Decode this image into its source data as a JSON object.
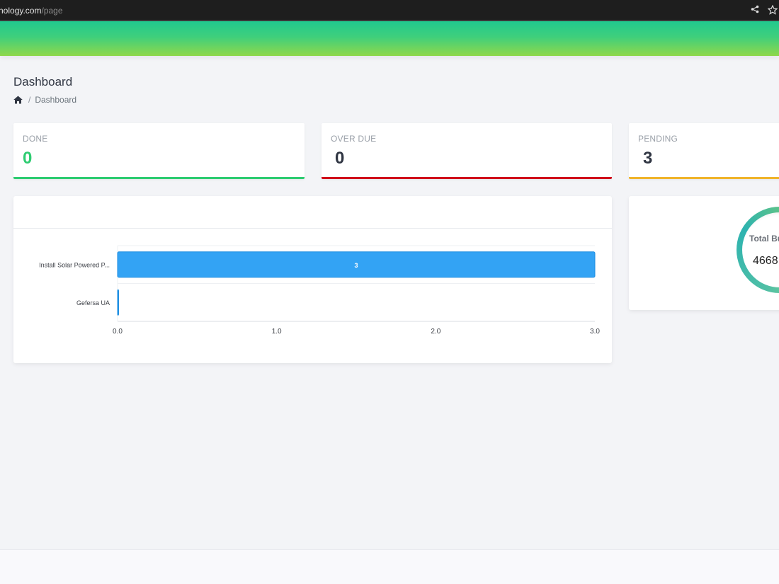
{
  "browser": {
    "url_host": "nology.com",
    "url_path": "/page",
    "share_icon": "share-icon",
    "star_icon": "star-icon"
  },
  "header": {
    "accent_gradient": [
      "#21c98f",
      "#8fd84a"
    ]
  },
  "page": {
    "title": "Dashboard",
    "breadcrumb": {
      "home_icon": "home-icon",
      "separator": "/",
      "current": "Dashboard"
    }
  },
  "stats": [
    {
      "label": "DONE",
      "value": "0",
      "color": "#2ecc71"
    },
    {
      "label": "OVER DUE",
      "value": "0",
      "color": "#d0021b"
    },
    {
      "label": "PENDING",
      "value": "3",
      "color": "#f0b42b"
    }
  ],
  "budget": {
    "title": "Total Bu",
    "value": "4668"
  },
  "chart_data": {
    "type": "bar",
    "orientation": "horizontal",
    "title": "",
    "xlabel": "",
    "ylabel": "",
    "categories": [
      "Install Solar Powered P...",
      "Gefersa UA"
    ],
    "values": [
      3,
      0
    ],
    "data_labels": [
      "3",
      ""
    ],
    "xlim": [
      0,
      3
    ],
    "x_ticks": [
      "0.0",
      "1.0",
      "2.0",
      "3.0"
    ],
    "bar_color": "#33a3f4",
    "grid": true
  }
}
